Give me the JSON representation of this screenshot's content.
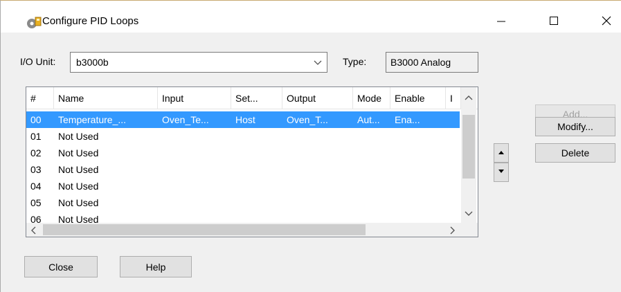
{
  "window": {
    "title": "Configure PID Loops",
    "controls": {
      "minimize": "—",
      "maximize": "☐",
      "close": "✕"
    }
  },
  "io_unit": {
    "label": "I/O Unit:",
    "value": "b3000b"
  },
  "type": {
    "label": "Type:",
    "value": "B3000 Analog"
  },
  "table": {
    "columns": [
      "#",
      "Name",
      "Input",
      "Set...",
      "Output",
      "Mode",
      "Enable",
      "I"
    ],
    "rows": [
      [
        "00",
        "Temperature_...",
        "Oven_Te...",
        "Host",
        "Oven_T...",
        "Aut...",
        "Ena..."
      ],
      [
        "01",
        "Not Used",
        "",
        "",
        "",
        "",
        ""
      ],
      [
        "02",
        "Not Used",
        "",
        "",
        "",
        "",
        ""
      ],
      [
        "03",
        "Not Used",
        "",
        "",
        "",
        "",
        ""
      ],
      [
        "04",
        "Not Used",
        "",
        "",
        "",
        "",
        ""
      ],
      [
        "05",
        "Not Used",
        "",
        "",
        "",
        "",
        ""
      ],
      [
        "06",
        "Not Used",
        "",
        "",
        "",
        "",
        ""
      ]
    ],
    "selected_row": 0
  },
  "buttons": {
    "add": "Add...",
    "modify": "Modify...",
    "delete": "Delete",
    "close": "Close",
    "help": "Help"
  }
}
